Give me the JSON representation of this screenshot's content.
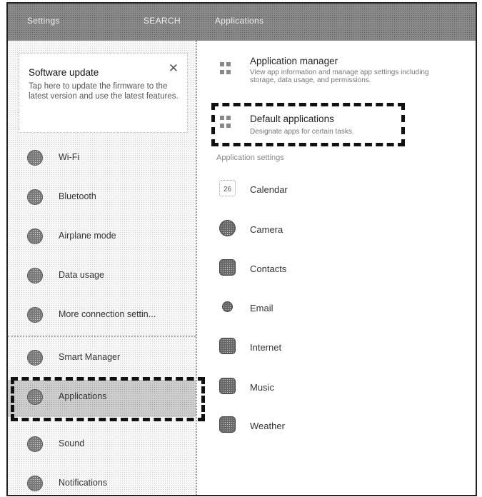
{
  "header": {
    "title": "Settings",
    "search_label": "SEARCH",
    "section_title": "Applications"
  },
  "update_card": {
    "title": "Software update",
    "close_symbol": "✕",
    "description": "Tap here to update the firmware to the latest version and use the latest features."
  },
  "sidebar": {
    "items": [
      {
        "label": "Wi-Fi"
      },
      {
        "label": "Bluetooth"
      },
      {
        "label": "Airplane mode"
      },
      {
        "label": "Data usage"
      },
      {
        "label": "More connection settin..."
      },
      {
        "label": "Smart Manager"
      },
      {
        "label": "Applications"
      },
      {
        "label": "Sound"
      },
      {
        "label": "Notifications"
      }
    ],
    "selected_index": 6
  },
  "main": {
    "app_manager": {
      "title": "Application manager",
      "description": "View app information and manage app settings including storage, data usage, and permissions."
    },
    "default_apps": {
      "title": "Default applications",
      "description": "Designate apps for certain tasks."
    },
    "section_header": "Application settings",
    "apps": [
      {
        "label": "Calendar",
        "icon": "calendar-icon",
        "badge": "26"
      },
      {
        "label": "Camera",
        "icon": "camera-icon"
      },
      {
        "label": "Contacts",
        "icon": "contacts-icon"
      },
      {
        "label": "Email",
        "icon": "email-icon"
      },
      {
        "label": "Internet",
        "icon": "internet-icon"
      },
      {
        "label": "Music",
        "icon": "music-icon"
      },
      {
        "label": "Weather",
        "icon": "weather-icon"
      }
    ]
  }
}
